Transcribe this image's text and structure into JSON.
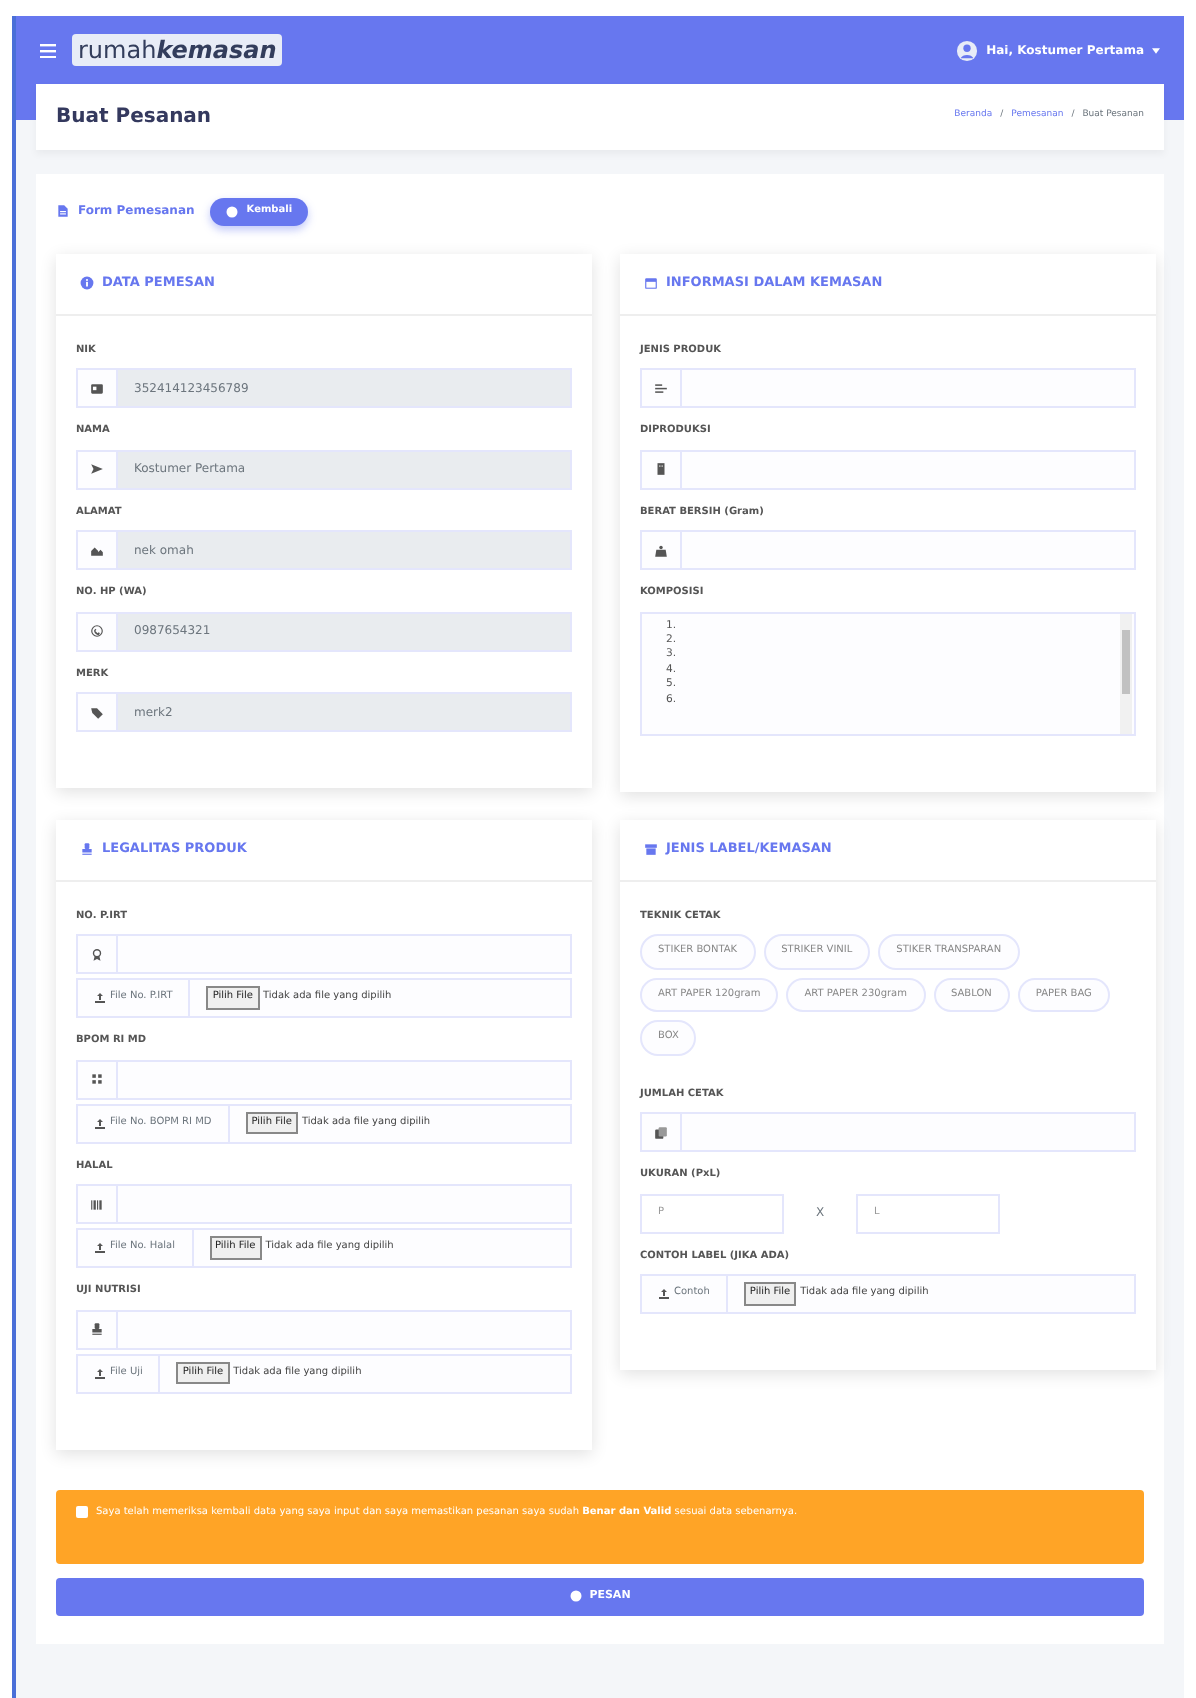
{
  "navbar": {
    "brand_plain": "rumah",
    "brand_bold": "kemasan",
    "user": "Hai, Kostumer Pertama"
  },
  "page_title": "Buat Pesanan",
  "breadcrumb": [
    {
      "label": "Beranda",
      "link": true
    },
    {
      "separator": "/",
      "label": "Pemesanan",
      "link": true
    },
    {
      "separator": "/",
      "label": "Buat Pesanan",
      "link": false
    }
  ],
  "form_header": {
    "title": "Form Pemesanan",
    "back_button": "Kembali"
  },
  "sections": [
    {
      "title": "DATA PEMESAN",
      "fields": [
        {
          "kind": "input",
          "label": "NIK",
          "value": "352414123456789",
          "disabled": true
        },
        {
          "kind": "input",
          "label": "NAMA",
          "value": "Kostumer Pertama",
          "disabled": true
        },
        {
          "kind": "input",
          "label": "ALAMAT",
          "value": "nek omah",
          "disabled": true
        },
        {
          "kind": "input",
          "label": "NO. HP (WA)",
          "value": "0987654321",
          "disabled": true
        },
        {
          "kind": "input",
          "label": "MERK",
          "value": "merk2",
          "disabled": true
        }
      ]
    },
    {
      "title": "INFORMASI DALAM KEMASAN",
      "fields": [
        {
          "kind": "input",
          "label": "JENIS PRODUK",
          "disabled": false
        },
        {
          "kind": "input",
          "label": "DIPRODUKSI",
          "disabled": false
        },
        {
          "kind": "input",
          "label": "BERAT BERSIH (Gram)",
          "disabled": false
        },
        {
          "kind": "textarea",
          "label": "KOMPOSISI",
          "value": "1.\n2.\n3.\n4.\n5.\n6."
        }
      ]
    },
    {
      "title": "LEGALITAS PRODUK",
      "fields": [
        {
          "kind": "input_file",
          "label": "NO. P.IRT",
          "disabled": false,
          "file_label": "File No. P.IRT",
          "file_button": "Pilih File",
          "file_status": "Tidak ada file yang dipilih"
        },
        {
          "kind": "input_file",
          "label": "BPOM RI MD",
          "disabled": false,
          "file_label": "File No. BOPM RI MD",
          "file_button": "Pilih File",
          "file_status": "Tidak ada file yang dipilih"
        },
        {
          "kind": "input_file",
          "label": "HALAL",
          "disabled": false,
          "file_label": "File No. Halal",
          "file_button": "Pilih File",
          "file_status": "Tidak ada file yang dipilih"
        },
        {
          "kind": "input_file",
          "label": "UJI NUTRISI",
          "disabled": false,
          "file_label": "File Uji",
          "file_button": "Pilih File",
          "file_status": "Tidak ada file yang dipilih"
        }
      ]
    },
    {
      "title": "JENIS LABEL/KEMASAN",
      "fields": [
        {
          "kind": "chips",
          "label": "TEKNIK CETAK",
          "options": [
            {
              "label": "STIKER BONTAK",
              "selected": false
            },
            {
              "label": "STRIKER VINIL",
              "selected": false
            },
            {
              "label": "STIKER TRANSPARAN",
              "selected": false
            },
            {
              "label": "ART PAPER 120gram",
              "selected": false
            },
            {
              "label": "ART PAPER 230gram",
              "selected": false
            },
            {
              "label": "SABLON",
              "selected": false
            },
            {
              "label": "PAPER BAG",
              "selected": false
            },
            {
              "label": "BOX",
              "selected": false
            }
          ]
        },
        {
          "kind": "input",
          "label": "JUMLAH CETAK",
          "disabled": false
        },
        {
          "kind": "size",
          "label": "UKURAN (PxL)",
          "placeholder_p": "P",
          "separator": "X",
          "placeholder_l": "L"
        },
        {
          "kind": "file",
          "label": "CONTOH LABEL (JIKA ADA)",
          "file_label": "Contoh",
          "file_button": "Pilih File",
          "file_status": "Tidak ada file yang dipilih"
        }
      ]
    }
  ],
  "agreement": {
    "checked": false,
    "text": "Saya telah memeriksa kembali data yang saya input dan saya memastikan pesanan saya sudah **Benar dan Valid** sesuai data sebenarnya."
  },
  "submit_button": "PESAN"
}
